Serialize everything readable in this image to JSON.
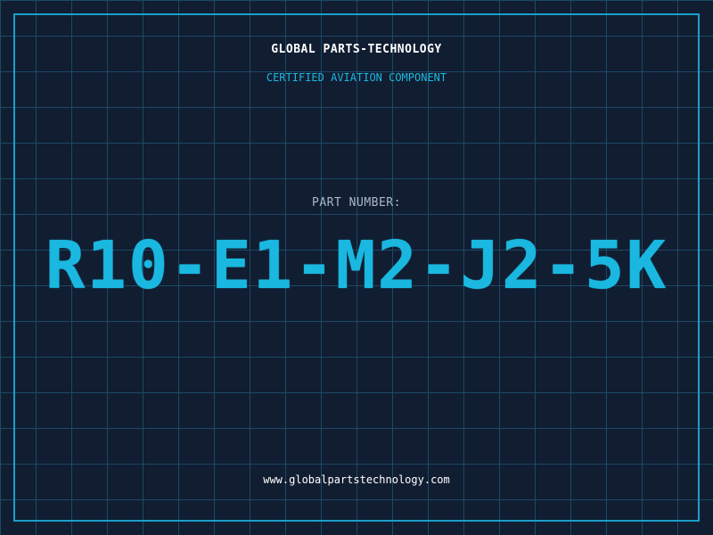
{
  "header": {
    "company": "GLOBAL PARTS-TECHNOLOGY",
    "tagline": "CERTIFIED AVIATION COMPONENT"
  },
  "part": {
    "label": "PART NUMBER:",
    "number": "R10-E1-M2-J2-5K"
  },
  "footer": {
    "url": "www.globalpartstechnology.com"
  },
  "colors": {
    "background": "#111d31",
    "grid": "#1a4a66",
    "accent": "#1ab8e0",
    "text": "#ffffff"
  }
}
